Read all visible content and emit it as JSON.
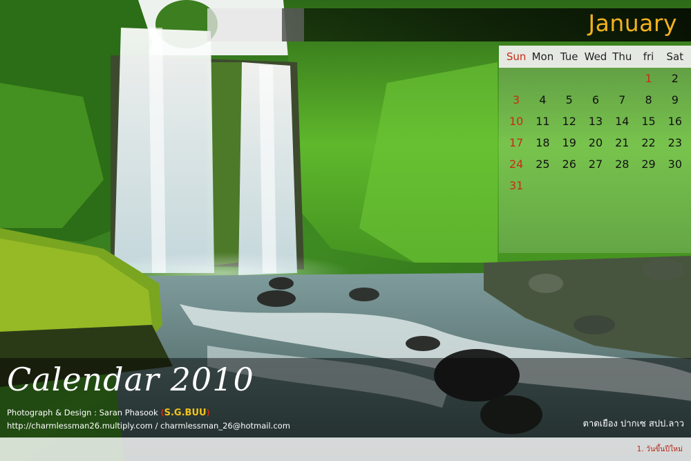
{
  "calendar": {
    "month": "January",
    "weekdays": [
      "Sun",
      "Mon",
      "Tue",
      "Wed",
      "Thu",
      "fri",
      "Sat"
    ],
    "weeks": [
      [
        "",
        "",
        "",
        "",
        "",
        "1",
        "2"
      ],
      [
        "3",
        "4",
        "5",
        "6",
        "7",
        "8",
        "9"
      ],
      [
        "10",
        "11",
        "12",
        "13",
        "14",
        "15",
        "16"
      ],
      [
        "17",
        "18",
        "19",
        "20",
        "21",
        "22",
        "23"
      ],
      [
        "24",
        "25",
        "26",
        "27",
        "28",
        "29",
        "30"
      ],
      [
        "31",
        "",
        "",
        "",
        "",
        "",
        ""
      ]
    ]
  },
  "footer": {
    "title": "Calendar 2010",
    "credit_prefix": "Photograph & Design : Saran Phasook ",
    "credit_badge": "S.G.BUU",
    "contact": "http://charmlessman26.multiply.com / charmlessman_26@hotmail.com",
    "location": "ตาดเยือง  ปากเซ  สปป.ลาว",
    "note": "1. วันขึ้นปีใหม่"
  },
  "colors": {
    "month_title": "#f3b21e",
    "sunday": "#c82a16",
    "holiday": "#c82a16"
  }
}
